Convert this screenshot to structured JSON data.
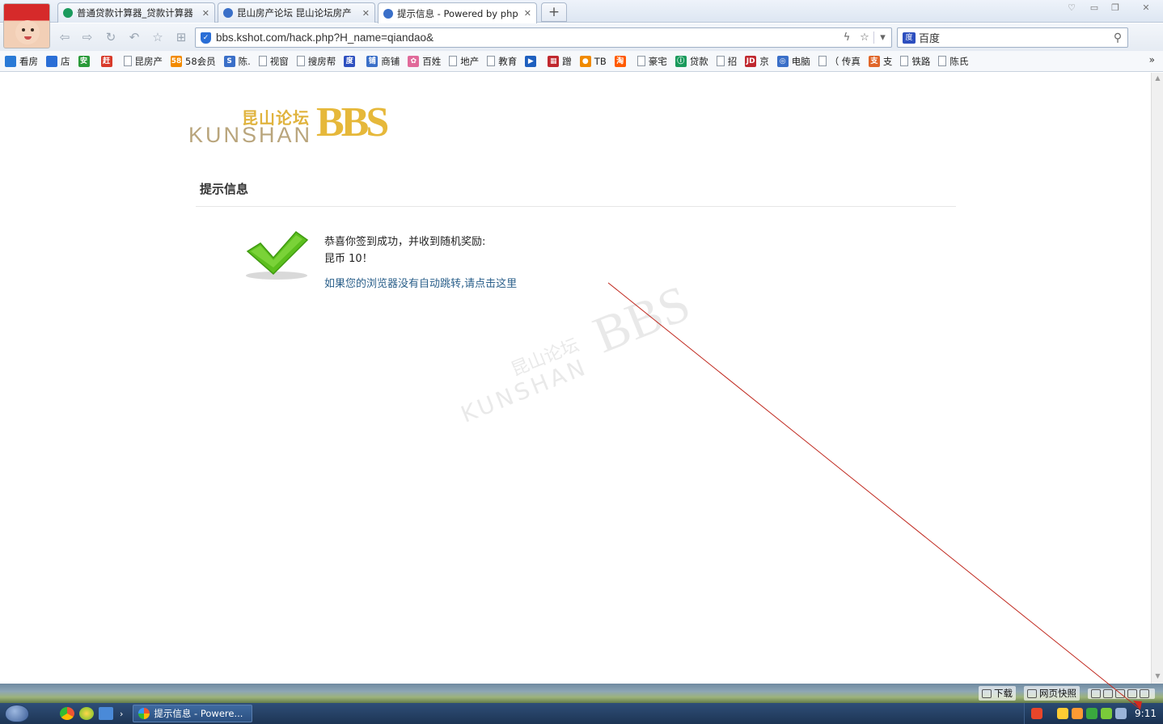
{
  "browser": {
    "tabs": [
      {
        "label": "普通贷款计算器_贷款计算器",
        "color": "#1a9a5c",
        "active": false
      },
      {
        "label": "昆山房产论坛 昆山论坛房产",
        "color": "#3a6fc8",
        "active": false
      },
      {
        "label": "提示信息 - Powered by php",
        "color": "#3a6fc8",
        "active": true
      }
    ],
    "new_tab": "+",
    "address": "bbs.kshot.com/hack.php?H_name=qiandao&",
    "search_engine": "百度"
  },
  "bookmarks": [
    {
      "label": "看房",
      "icon": "globe-icon",
      "color": "#2a7ad6"
    },
    {
      "label": "店",
      "icon": "home-icon",
      "color": "#2a6ed6"
    },
    {
      "label": "",
      "icon": "an-icon",
      "color": "#2a9a3a",
      "glyph": "安"
    },
    {
      "label": "",
      "icon": "ganji-icon",
      "color": "#d83a2a",
      "glyph": "赶"
    },
    {
      "label": "昆房产",
      "icon": "page-icon",
      "color": ""
    },
    {
      "label": "58会员",
      "icon": "58-icon",
      "color": "#f28a00",
      "glyph": "58"
    },
    {
      "label": "陈.",
      "icon": "s-icon",
      "color": "#3a6fc8",
      "glyph": "S"
    },
    {
      "label": "视窗",
      "icon": "page-icon",
      "color": ""
    },
    {
      "label": "搜房帮",
      "icon": "page-icon",
      "color": ""
    },
    {
      "label": "",
      "icon": "paw-icon",
      "color": "#2d4fbf",
      "glyph": "度"
    },
    {
      "label": "商铺",
      "icon": "shop-icon",
      "color": "#3a6fc8",
      "glyph": "铺"
    },
    {
      "label": "百姓",
      "icon": "baixing-icon",
      "color": "#e06a9a",
      "glyph": "✿"
    },
    {
      "label": "地产",
      "icon": "page-icon",
      "color": ""
    },
    {
      "label": "教育",
      "icon": "page-icon",
      "color": ""
    },
    {
      "label": "",
      "icon": "play-icon",
      "color": "#1e5fbf",
      "glyph": "▶"
    },
    {
      "label": "蹭",
      "icon": "qr-icon",
      "color": "#c0282f",
      "glyph": "▦"
    },
    {
      "label": "TB",
      "icon": "tb-icon",
      "color": "#f08a00",
      "glyph": "●"
    },
    {
      "label": "",
      "icon": "taobao-icon",
      "color": "#ff5a00",
      "glyph": "淘"
    },
    {
      "label": "豪宅",
      "icon": "page-icon",
      "color": ""
    },
    {
      "label": "贷款",
      "icon": "loan-icon",
      "color": "#1a9a5c",
      "glyph": "ⓘ"
    },
    {
      "label": "招",
      "icon": "page-icon",
      "color": ""
    },
    {
      "label": "京",
      "icon": "jd-icon",
      "color": "#c0282f",
      "glyph": "JD"
    },
    {
      "label": "电脑",
      "icon": "pc-icon",
      "color": "#3a6fc8",
      "glyph": "◎"
    },
    {
      "label": "（ 传真",
      "icon": "page-icon",
      "color": ""
    },
    {
      "label": "支",
      "icon": "alipay-icon",
      "color": "#e0662a",
      "glyph": "支"
    },
    {
      "label": "铁路",
      "icon": "page-icon",
      "color": ""
    },
    {
      "label": "陈氏",
      "icon": "page-icon",
      "color": ""
    }
  ],
  "bookmarks_more": "»",
  "page": {
    "logo_cn": "昆山论坛",
    "logo_en": "KUNSHAN",
    "logo_bbs": "BBS",
    "title": "提示信息",
    "message_line1": "恭喜你签到成功，并收到随机奖励:",
    "message_line2": "昆币 10！",
    "redirect_link": "如果您的浏览器没有自动跳转,请点击这里",
    "accent_link_color": "#2a5f8a"
  },
  "statusbar": [
    {
      "label": "下载",
      "icon": "download-icon"
    },
    {
      "label": "网页快照",
      "icon": "camera-icon"
    }
  ],
  "taskbar": {
    "task_label": "提示信息 - Powere...",
    "clock": "9:11"
  }
}
